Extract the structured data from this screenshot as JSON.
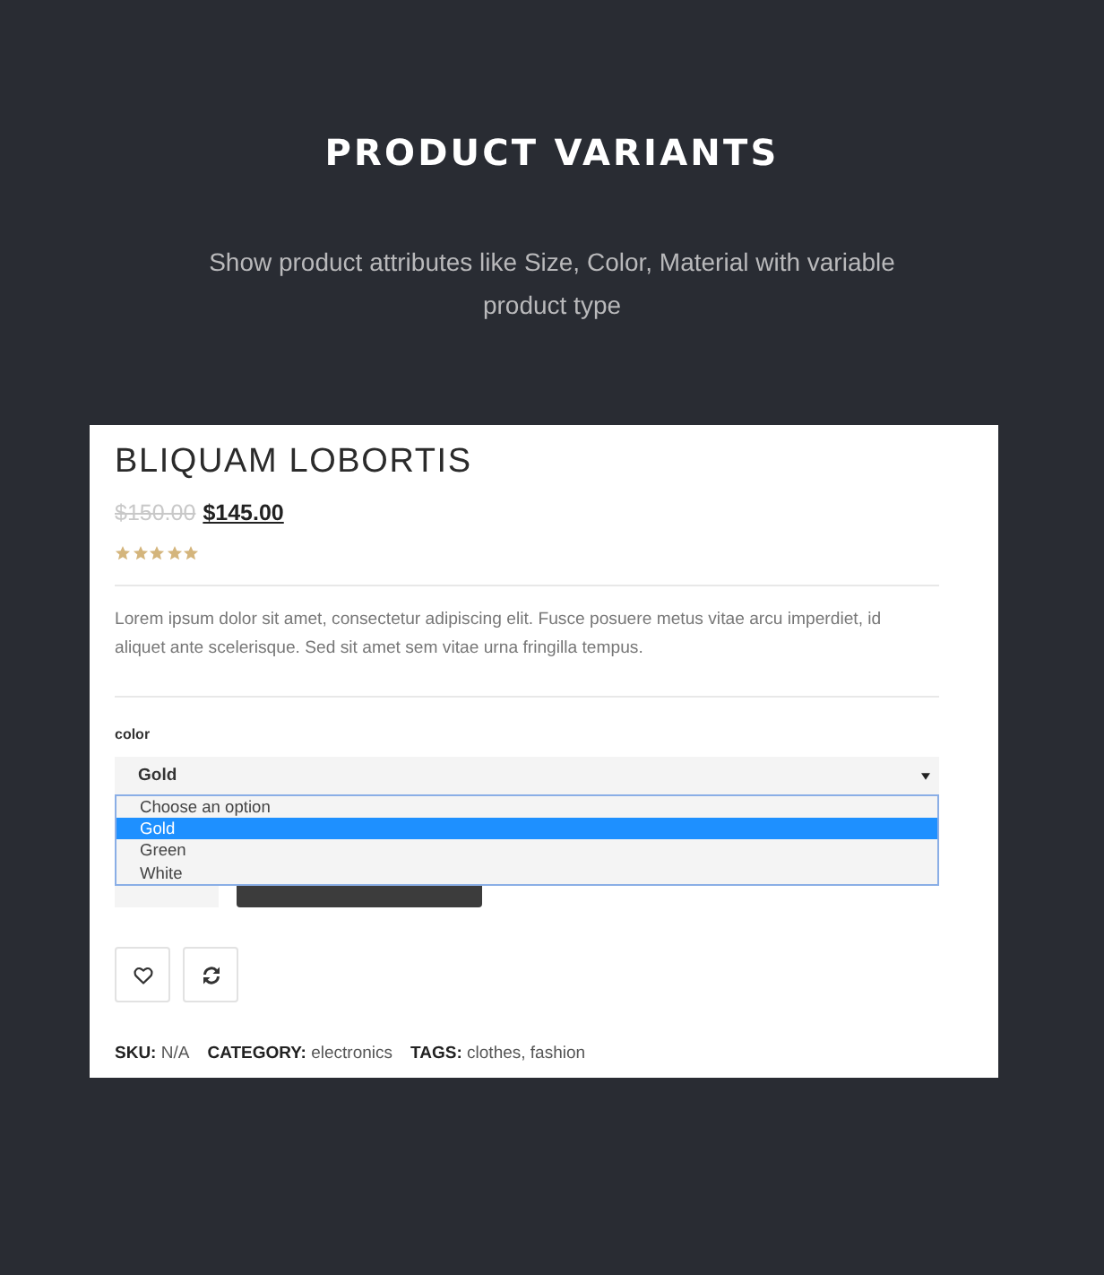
{
  "header": {
    "title": "PRODUCT VARIANTS",
    "subtitle": "Show product attributes like Size, Color, Material with variable product type"
  },
  "product": {
    "name": "BLIQUAM LOBORTIS",
    "old_price": "$150.00",
    "price": "$145.00",
    "stars": 5,
    "description": "Lorem ipsum dolor sit amet, consectetur adipiscing elit. Fusce posuere metus vitae arcu imperdiet, id aliquet ante scelerisque. Sed sit amet sem vitae urna fringilla tempus.",
    "variation": {
      "label": "color",
      "value": "Gold",
      "expanded": true,
      "options": [
        {
          "label": "Choose an option",
          "selected": false
        },
        {
          "label": "Gold",
          "selected": true
        },
        {
          "label": "Green",
          "selected": false
        },
        {
          "label": "White",
          "selected": false
        }
      ]
    },
    "meta": [
      {
        "label": "SKU:",
        "value": "N/A"
      },
      {
        "label": "CATEGORY:",
        "value": "electronics"
      },
      {
        "label": "TAGS:",
        "value": "clothes, fashion"
      }
    ]
  }
}
